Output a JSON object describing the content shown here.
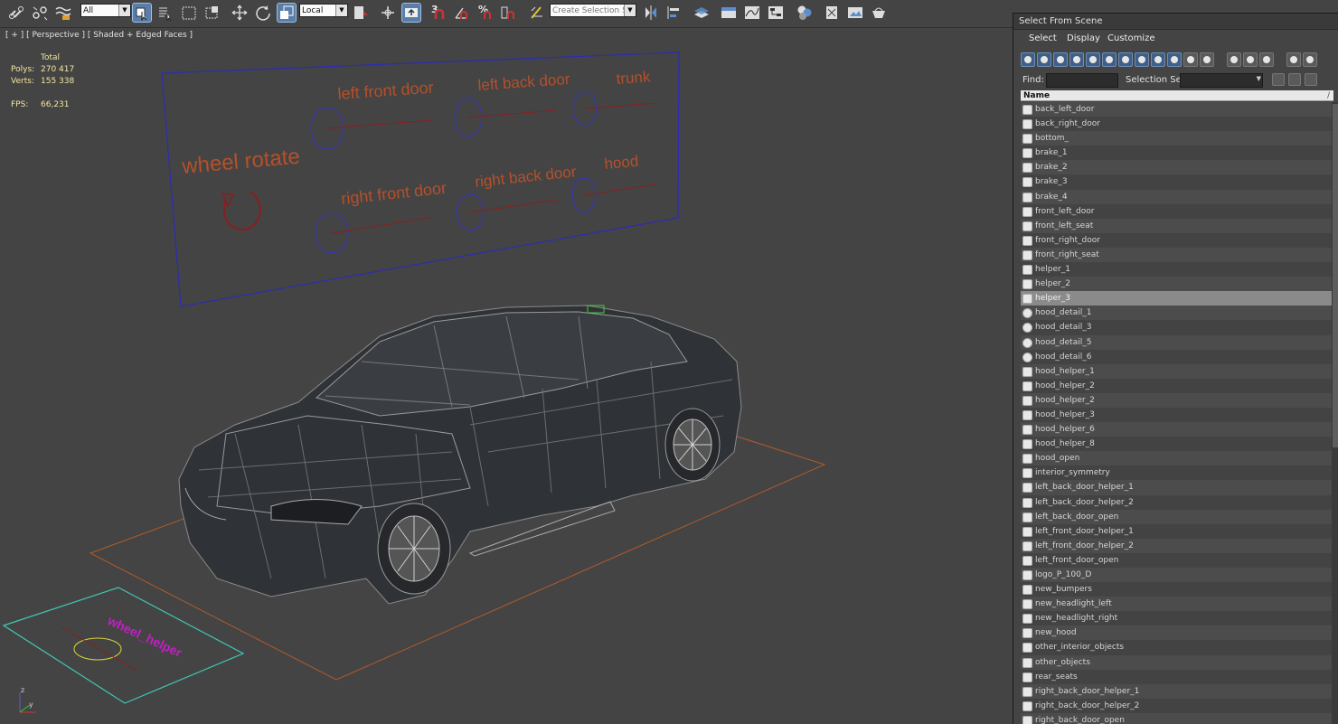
{
  "toolbar": {
    "filter_selected": "All",
    "coord_system": "Local",
    "named_selection_placeholder": "Create Selection Se",
    "snap_label": "3",
    "percent_snap_label": "%",
    "icons": [
      "link-icon",
      "unlink-icon",
      "bind-space-warp-icon",
      "select-object-icon",
      "select-by-name-icon",
      "rect-region-icon",
      "window-crossing-icon",
      "move-icon",
      "rotate-icon",
      "scale-icon",
      "pivot-icon",
      "select-manipulate-icon",
      "keyboard-shortcut-icon",
      "snaps-toggle-icon",
      "angle-snap-icon",
      "percent-snap-icon",
      "spinner-snap-icon",
      "edit-named-selection-icon",
      "mirror-icon",
      "align-icon",
      "layer-manager-icon",
      "ribbon-icon",
      "curve-editor-icon",
      "schematic-view-icon",
      "material-editor-icon",
      "render-setup-icon",
      "rendered-frame-icon",
      "render-icon",
      "render-production-icon"
    ]
  },
  "viewport": {
    "label": "[ + ] [ Perspective ] [ Shaded + Edged Faces ]",
    "stats": {
      "total_label": "Total",
      "polys_label": "Polys:",
      "polys_value": "270 417",
      "verts_label": "Verts:",
      "verts_value": "155 338",
      "fps_label": "FPS:",
      "fps_value": "66,231"
    },
    "panel_labels": {
      "wheel_rotate": "wheel rotate",
      "left_front_door": "left front door",
      "left_back_door": "left back door",
      "trunk": "trunk",
      "right_front_door": "right front door",
      "right_back_door": "right back door",
      "hood": "hood"
    },
    "axis_x": "x",
    "axis_y": "y",
    "axis_z": "z",
    "colors": {
      "panel_border": "#2c2cb5",
      "panel_text": "#b5502a",
      "ground_plane": "#b25a2a",
      "helper_plane": "#3fc7b5",
      "helper_text": "#c51ec5",
      "car_wire": "#8a8a8a",
      "car_fill": "#2f3236",
      "stats_text": "#f2e6a0"
    }
  },
  "dialog": {
    "title": "Select From Scene",
    "menu": [
      "Select",
      "Display",
      "Customize"
    ],
    "find_label": "Find:",
    "find_value": "",
    "selection_set_label": "Selection Set:",
    "selection_set_value": "",
    "column_name": "Name",
    "selected_item": "helper_3",
    "items": [
      "back_left_door",
      "back_right_door",
      "bottom_",
      "brake_1",
      "brake_2",
      "brake_3",
      "brake_4",
      "front_left_door",
      "front_left_seat",
      "front_right_door",
      "front_right_seat",
      "helper_1",
      "helper_2",
      "helper_3",
      "hood_detail_1",
      "hood_detail_3",
      "hood_detail_5",
      "hood_detail_6",
      "hood_helper_1",
      "hood_helper_2",
      "hood_helper_2",
      "hood_helper_3",
      "hood_helper_6",
      "hood_helper_8",
      "hood_open",
      "interior_symmetry",
      "left_back_door_helper_1",
      "left_back_door_helper_2",
      "left_back_door_open",
      "left_front_door_helper_1",
      "left_front_door_helper_2",
      "left_front_door_open",
      "logo_P_100_D",
      "new_bumpers",
      "new_headlight_left",
      "new_headlight_right",
      "new_hood",
      "other_interior_objects",
      "other_objects",
      "rear_seats",
      "right_back_door_helper_1",
      "right_back_door_helper_2",
      "right_back_door_open"
    ]
  }
}
